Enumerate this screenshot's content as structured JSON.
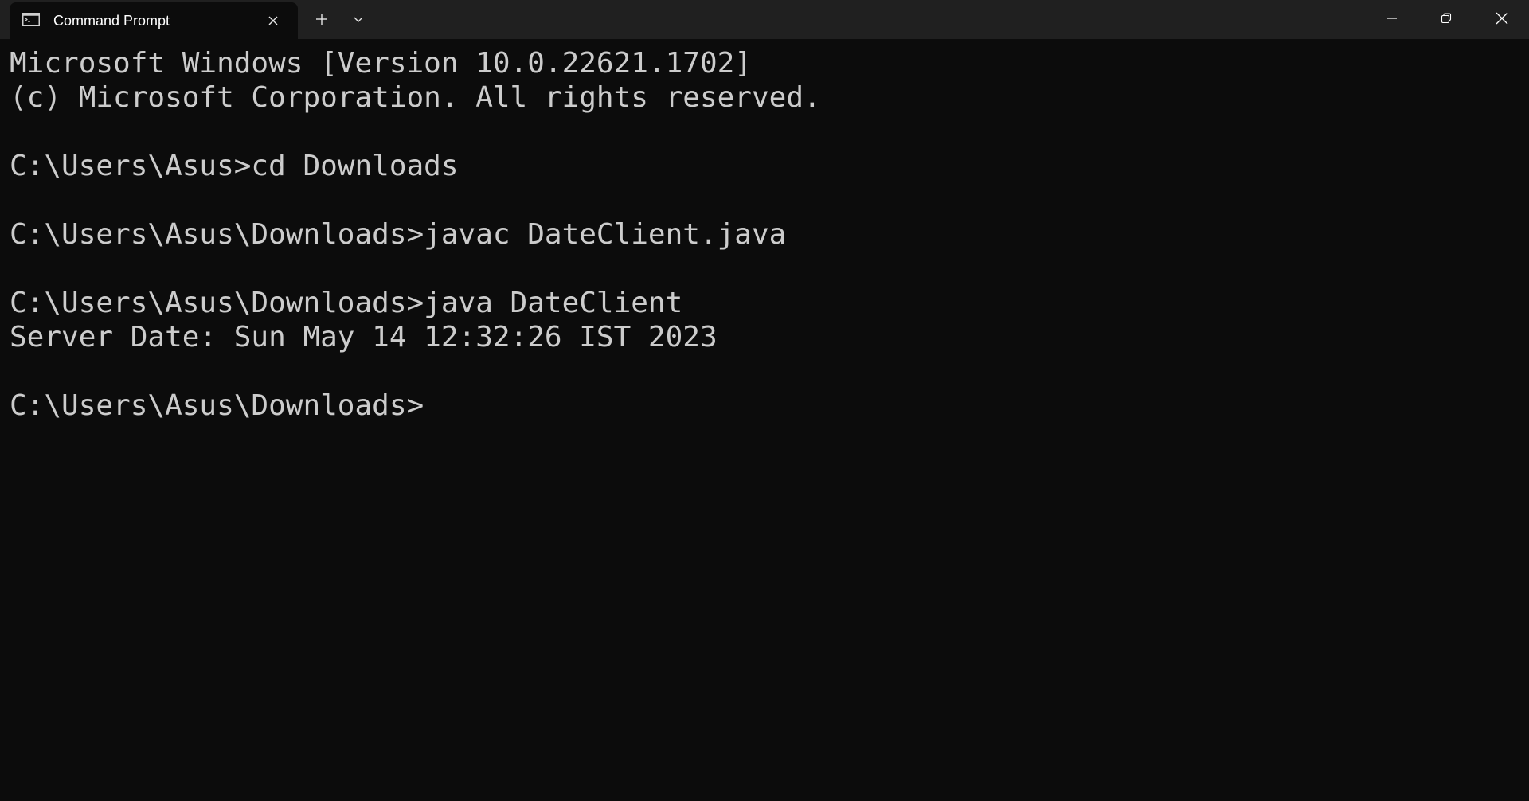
{
  "tab": {
    "title": "Command Prompt",
    "icon": "terminal-icon"
  },
  "titlebar_buttons": {
    "new_tab": "plus-icon",
    "dropdown": "chevron-down-icon",
    "minimize": "minimize-icon",
    "maximize": "restore-icon",
    "close": "close-icon"
  },
  "console": {
    "lines": [
      "Microsoft Windows [Version 10.0.22621.1702]",
      "(c) Microsoft Corporation. All rights reserved.",
      "",
      "C:\\Users\\Asus>cd Downloads",
      "",
      "C:\\Users\\Asus\\Downloads>javac DateClient.java",
      "",
      "C:\\Users\\Asus\\Downloads>java DateClient",
      "Server Date: Sun May 14 12:32:26 IST 2023",
      "",
      "C:\\Users\\Asus\\Downloads>"
    ]
  },
  "colors": {
    "background": "#0c0c0c",
    "titlebar": "#202020",
    "text": "#cccccc"
  }
}
